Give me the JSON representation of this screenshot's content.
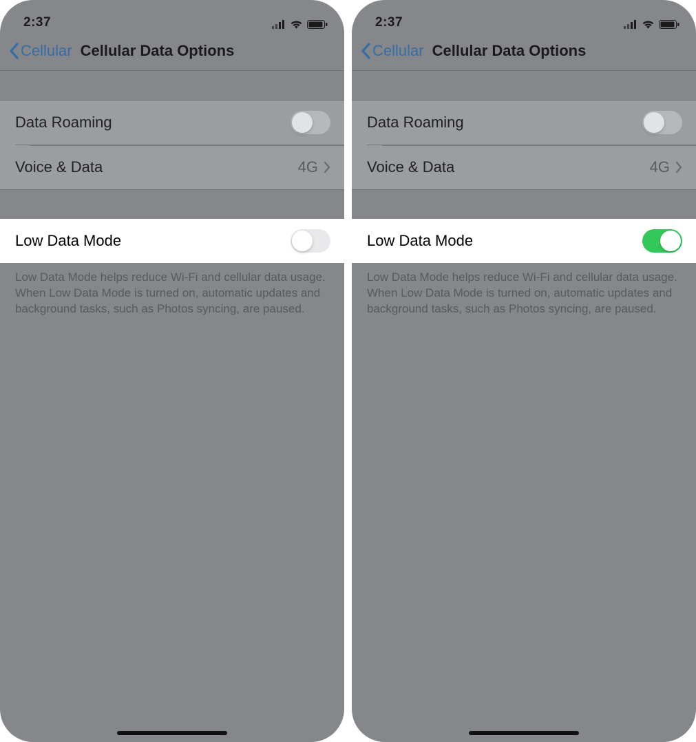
{
  "status": {
    "time": "2:37"
  },
  "nav": {
    "back_label": "Cellular",
    "title": "Cellular Data Options"
  },
  "group1": {
    "roaming_label": "Data Roaming",
    "voice_label": "Voice & Data",
    "voice_value": "4G"
  },
  "group2": {
    "low_data_label": "Low Data Mode",
    "footer": "Low Data Mode helps reduce Wi-Fi and cellular data usage. When Low Data Mode is turned on, automatic updates and background tasks, such as Photos syncing, are paused."
  },
  "panes": {
    "left": {
      "low_data_on": false
    },
    "right": {
      "low_data_on": true
    }
  },
  "colors": {
    "accent_blue": "#356da7",
    "accent_green": "#34c759"
  }
}
